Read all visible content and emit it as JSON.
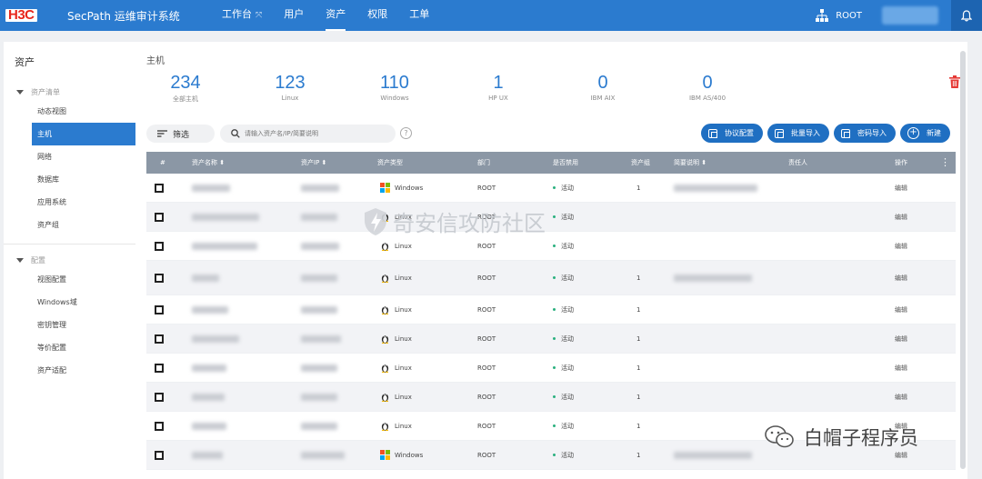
{
  "app": {
    "logo_text": "H3C",
    "title": "SecPath 运维审计系统",
    "nav": [
      {
        "label": "工作台",
        "sub": "⤧"
      },
      {
        "label": "用户"
      },
      {
        "label": "资产"
      },
      {
        "label": "权限"
      },
      {
        "label": "工单"
      }
    ],
    "active_nav": "资产",
    "user": "ROOT",
    "accent": "#2b7bcf"
  },
  "sidebar": {
    "title": "资产",
    "groups": [
      {
        "label": "资产清单",
        "items": [
          "动态视图",
          "主机",
          "网络",
          "数据库",
          "应用系统",
          "资产组"
        ]
      },
      {
        "label": "配置",
        "items": [
          "视图配置",
          "Windows域",
          "密钥管理",
          "等价配置",
          "资产适配"
        ]
      }
    ],
    "active_item": "主机"
  },
  "main": {
    "title": "主机",
    "stats": [
      {
        "num": "234",
        "label": "全部主机"
      },
      {
        "num": "123",
        "label": "Linux"
      },
      {
        "num": "110",
        "label": "Windows"
      },
      {
        "num": "1",
        "label": "HP UX"
      },
      {
        "num": "0",
        "label": "IBM AIX"
      },
      {
        "num": "0",
        "label": "IBM AS/400"
      }
    ],
    "filter_label": "筛选",
    "search_placeholder": "请输入资产名/IP/简要说明",
    "help": "?",
    "actions": [
      "协议配置",
      "批量导入",
      "密码导入",
      "新建"
    ],
    "columns": [
      "#",
      "资产名称 ⬍",
      "资产IP ⬍",
      "资产类型",
      "部门",
      "是否禁用",
      "资产组",
      "简要说明 ⬍",
      "责任人",
      "操作"
    ],
    "menu_icon": "⋮",
    "rows": [
      {
        "type": "Windows",
        "dept": "ROOT",
        "status": "活动",
        "group": "1",
        "op": "编辑"
      },
      {
        "type": "Linux",
        "dept": "ROOT",
        "status": "活动",
        "group": "",
        "op": "编辑"
      },
      {
        "type": "Linux",
        "dept": "ROOT",
        "status": "活动",
        "group": "",
        "op": "编辑"
      },
      {
        "type": "Linux",
        "dept": "ROOT",
        "status": "活动",
        "group": "1",
        "op": "编辑"
      },
      {
        "type": "Linux",
        "dept": "ROOT",
        "status": "活动",
        "group": "1",
        "op": "编辑"
      },
      {
        "type": "Linux",
        "dept": "ROOT",
        "status": "活动",
        "group": "1",
        "op": "编辑"
      },
      {
        "type": "Linux",
        "dept": "ROOT",
        "status": "活动",
        "group": "1",
        "op": "编辑"
      },
      {
        "type": "Linux",
        "dept": "ROOT",
        "status": "活动",
        "group": "1",
        "op": "编辑"
      },
      {
        "type": "Linux",
        "dept": "ROOT",
        "status": "活动",
        "group": "1",
        "op": "编辑"
      },
      {
        "type": "Windows",
        "dept": "ROOT",
        "status": "活动",
        "group": "1",
        "op": "编辑"
      }
    ]
  },
  "watermark": "奇安信攻防社区",
  "wechat": "白帽子程序员"
}
